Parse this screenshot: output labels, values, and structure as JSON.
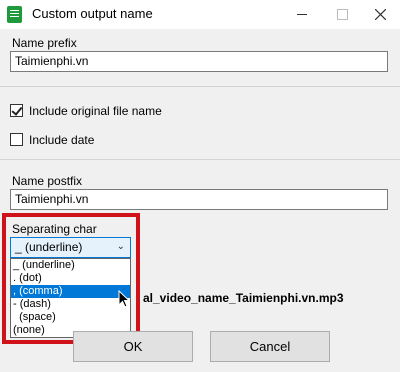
{
  "window": {
    "title": "Custom output name"
  },
  "prefix": {
    "label": "Name prefix",
    "value": "Taimienphi.vn"
  },
  "options": {
    "include_original": {
      "label": "Include original file name",
      "checked": true
    },
    "include_date": {
      "label": "Include date",
      "checked": false
    }
  },
  "postfix": {
    "label": "Name postfix",
    "value": "Taimienphi.vn"
  },
  "separator": {
    "label": "Separating char",
    "selected": "_ (underline)",
    "options": [
      "_ (underline)",
      ". (dot)",
      ", (comma)",
      "- (dash)",
      "  (space)",
      "(none)"
    ],
    "hover_index": 2
  },
  "preview": {
    "text": "al_video_name_Taimienphi.vn.mp3"
  },
  "buttons": {
    "ok": "OK",
    "cancel": "Cancel"
  },
  "colors": {
    "highlight_frame": "#d0121a",
    "selection": "#0078d7"
  }
}
